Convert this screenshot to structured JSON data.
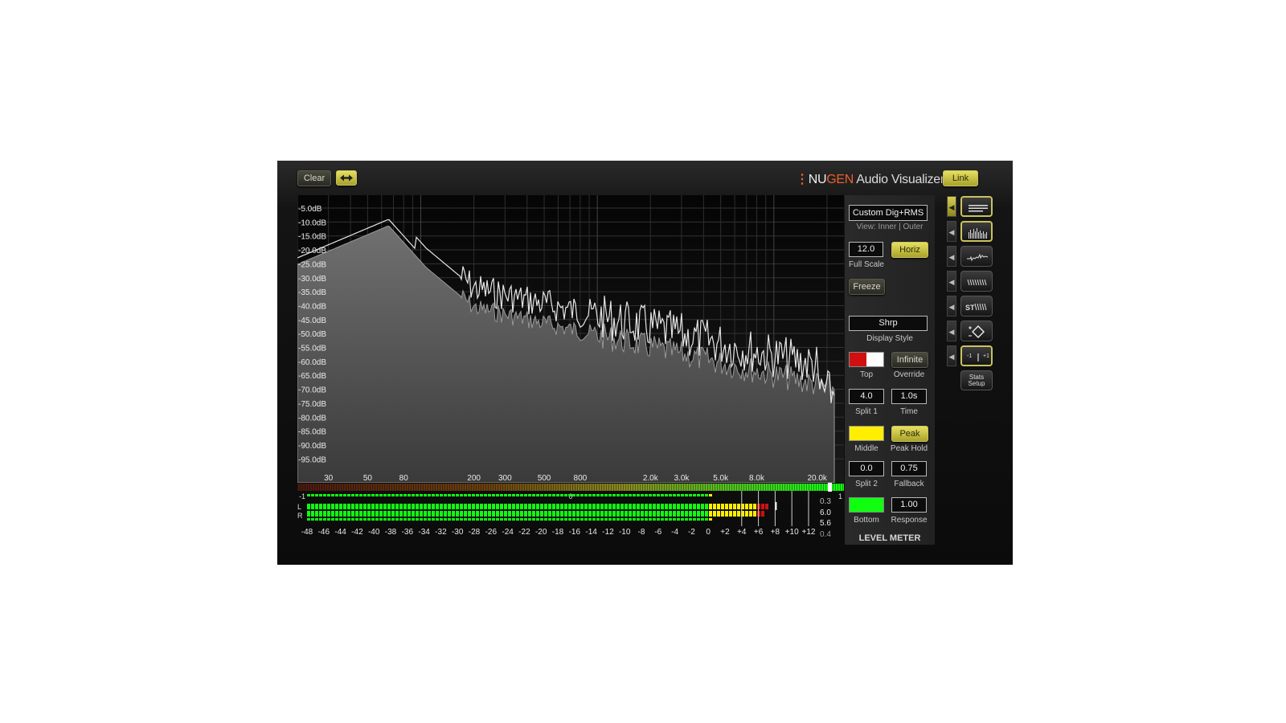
{
  "toolbar": {
    "clear_label": "Clear",
    "link_label": "Link"
  },
  "brand": {
    "name_nu": "NU",
    "name_gen": "GEN",
    "product": " Audio Visualizer"
  },
  "spectrum": {
    "db_labels": [
      "-5.0dB",
      "-10.0dB",
      "-15.0dB",
      "-20.0dB",
      "-25.0dB",
      "-30.0dB",
      "-35.0dB",
      "-40.0dB",
      "-45.0dB",
      "-50.0dB",
      "-55.0dB",
      "-60.0dB",
      "-65.0dB",
      "-70.0dB",
      "-75.0dB",
      "-80.0dB",
      "-85.0dB",
      "-90.0dB",
      "-95.0dB"
    ],
    "freq_labels": [
      "30",
      "50",
      "80",
      "200",
      "300",
      "500",
      "800",
      "2.0k",
      "3.0k",
      "5.0k",
      "8.0k",
      "20.0k"
    ],
    "correlation": {
      "left": "-1",
      "center": "0",
      "right": "1"
    }
  },
  "panel": {
    "preset": "Custom Dig+RMS",
    "view_label": "View: Inner | Outer",
    "full_scale_value": "12.0",
    "full_scale_label": "Full Scale",
    "horiz_label": "Horiz",
    "freeze_label": "Freeze",
    "display_style_value": "Shrp",
    "display_style_label": "Display Style",
    "top_label": "Top",
    "infinite_label": "Infinite",
    "override_label": "Override",
    "split1_value": "4.0",
    "split1_label": "Split 1",
    "time_value": "1.0s",
    "time_label": "Time",
    "middle_label": "Middle",
    "peak_label": "Peak",
    "peak_hold_label": "Peak Hold",
    "split2_value": "0.0",
    "split2_label": "Split 2",
    "fallback_value": "0.75",
    "fallback_label": "Fallback",
    "bottom_label": "Bottom",
    "response_value": "1.00",
    "response_label": "Response",
    "section_title": "LEVEL METER"
  },
  "level_meter": {
    "channels": [
      "L",
      "R"
    ],
    "scale": [
      "-48",
      "-46",
      "-44",
      "-42",
      "-40",
      "-38",
      "-36",
      "-34",
      "-32",
      "-30",
      "-28",
      "-26",
      "-24",
      "-22",
      "-20",
      "-18",
      "-16",
      "-14",
      "-12",
      "-10",
      "-8",
      "-6",
      "-4",
      "-2",
      "0",
      "+2",
      "+4",
      "+6",
      "+8",
      "+10",
      "+12"
    ],
    "readouts": [
      "0.3",
      "6.0",
      "5.6",
      "0.4"
    ]
  },
  "side": {
    "stats_line1": "Stats",
    "stats_line2": "Setup",
    "st_label": "ST"
  },
  "colors": {
    "top": "#d01010",
    "top_alt": "#ffffff",
    "middle": "#ffee00",
    "bottom": "#10ff10",
    "accent": "#c9c260"
  }
}
